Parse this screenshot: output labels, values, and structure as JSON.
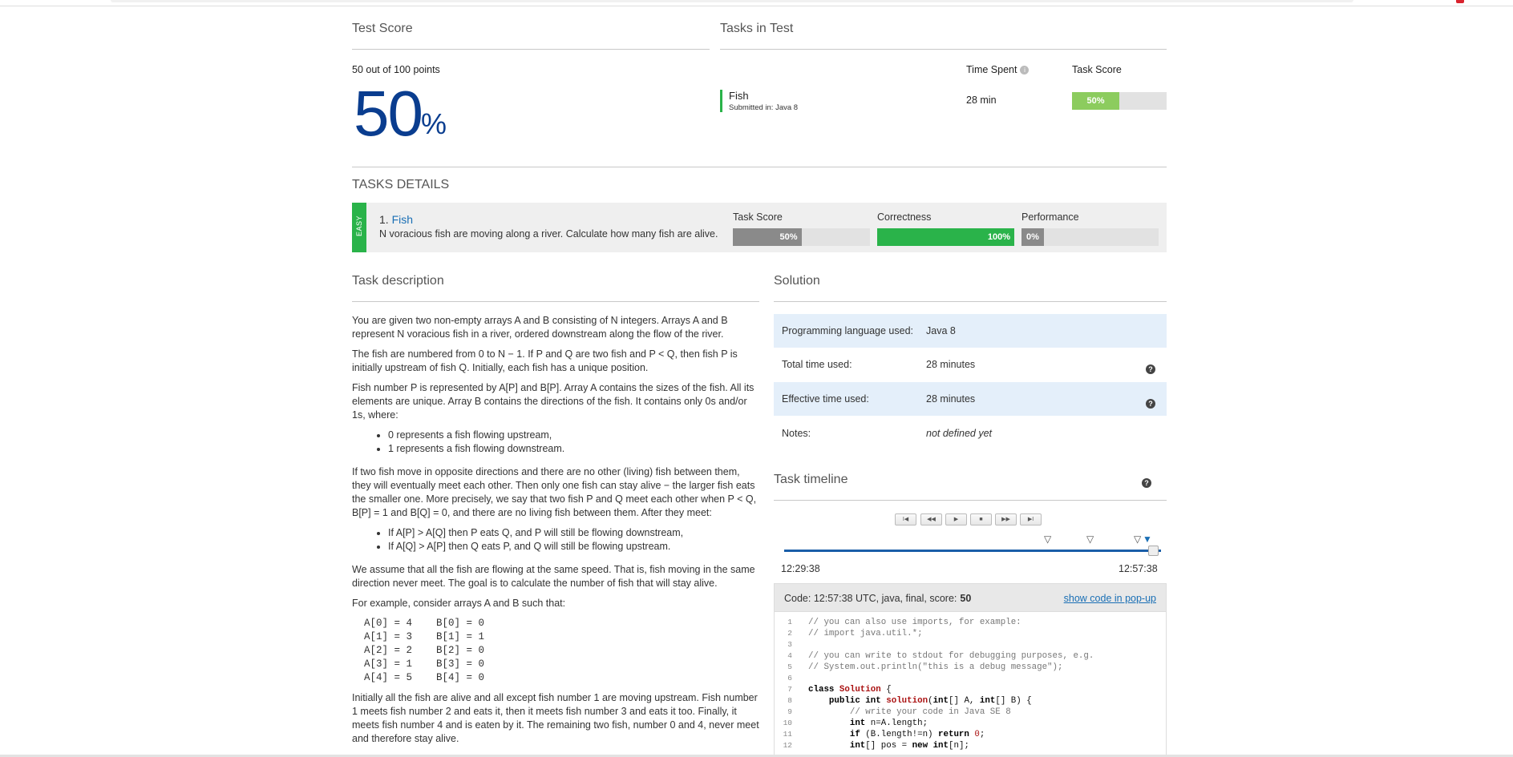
{
  "test_score": {
    "title": "Test Score",
    "points": "50 out of 100 points",
    "percent": "50",
    "percent_sign": "%"
  },
  "tasks_in_test": {
    "title": "Tasks in Test",
    "col_time_spent": "Time Spent",
    "col_task_score": "Task Score",
    "task": {
      "name": "Fish",
      "submitted": "Submitted in: Java 8",
      "time": "28 min",
      "score_label": "50%",
      "score_value": 50
    }
  },
  "tasks_details": {
    "title": "TASKS DETAILS",
    "difficulty": "EASY",
    "number": "1.",
    "name": "Fish",
    "description": "N voracious fish are moving along a river. Calculate how many fish are alive.",
    "task_score": {
      "label": "Task Score",
      "value_label": "50%",
      "value": 50
    },
    "correctness": {
      "label": "Correctness",
      "value_label": "100%",
      "value": 100
    },
    "performance": {
      "label": "Performance",
      "value_label": "0%",
      "value": 0
    }
  },
  "task_description": {
    "title": "Task description",
    "p1": "You are given two non-empty arrays A and B consisting of N integers. Arrays A and B represent N voracious fish in a river, ordered downstream along the flow of the river.",
    "p2": "The fish are numbered from 0 to N − 1. If P and Q are two fish and P < Q, then fish P is initially upstream of fish Q. Initially, each fish has a unique position.",
    "p3": "Fish number P is represented by A[P] and B[P]. Array A contains the sizes of the fish. All its elements are unique. Array B contains the directions of the fish. It contains only 0s and/or 1s, where:",
    "list1": [
      "0 represents a fish flowing upstream,",
      "1 represents a fish flowing downstream."
    ],
    "p4": "If two fish move in opposite directions and there are no other (living) fish between them, they will eventually meet each other. Then only one fish can stay alive − the larger fish eats the smaller one. More precisely, we say that two fish P and Q meet each other when P < Q, B[P] = 1 and B[Q] = 0, and there are no living fish between them. After they meet:",
    "list2": [
      "If A[P] > A[Q] then P eats Q, and P will still be flowing downstream,",
      "If A[Q] > A[P] then Q eats P, and Q will still be flowing upstream."
    ],
    "p5": "We assume that all the fish are flowing at the same speed. That is, fish moving in the same direction never meet. The goal is to calculate the number of fish that will stay alive.",
    "p6": "For example, consider arrays A and B such that:",
    "example": "A[0] = 4    B[0] = 0\nA[1] = 3    B[1] = 1\nA[2] = 2    B[2] = 0\nA[3] = 1    B[3] = 0\nA[4] = 5    B[4] = 0",
    "p7": "Initially all the fish are alive and all except fish number 1 are moving upstream. Fish number 1 meets fish number 2 and eats it, then it meets fish number 3 and eats it too. Finally, it meets fish number 4 and is eaten by it. The remaining two fish, number 0 and 4, never meet and therefore stay alive."
  },
  "solution": {
    "title": "Solution",
    "rows": [
      {
        "key": "Programming language used:",
        "value": "Java 8"
      },
      {
        "key": "Total time used:",
        "value": "28 minutes"
      },
      {
        "key": "Effective time used:",
        "value": "28 minutes"
      },
      {
        "key": "Notes:",
        "value": "not defined yet"
      }
    ]
  },
  "timeline": {
    "title": "Task timeline",
    "buttons": [
      "first-icon",
      "rewind-icon",
      "play-icon",
      "stop-icon",
      "forward-icon",
      "last-icon"
    ],
    "start": "12:29:38",
    "end": "12:57:38"
  },
  "code": {
    "header": "Code: 12:57:38 UTC, java, final, score:",
    "score": "50",
    "popup_link": "show code in pop-up",
    "lines": [
      "// you can also use imports, for example:",
      "// import java.util.*;",
      "",
      "// you can write to stdout for debugging purposes, e.g.",
      "// System.out.println(\"this is a debug message\");",
      "",
      "class Solution {",
      "    public int solution(int[] A, int[] B) {",
      "        // write your code in Java SE 8",
      "        int n=A.length;",
      "        if (B.length!=n) return 0;",
      "        int[] pos = new int[n];"
    ]
  }
}
